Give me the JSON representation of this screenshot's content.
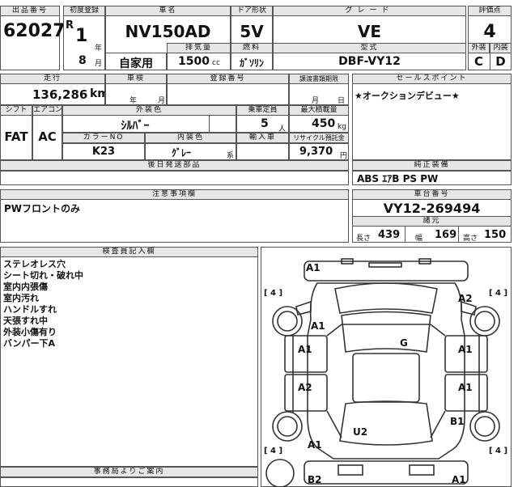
{
  "row1": {
    "lot_label": "出品番号",
    "lot": "62027",
    "reg_label": "初度登録",
    "era": "R",
    "year": "1",
    "year_unit": "年",
    "month": "8",
    "month_unit": "月",
    "car_label": "車名",
    "car": "NV150AD",
    "use": "自家用",
    "disp_label": "排気量",
    "disp": "1500",
    "disp_unit": "cc",
    "door_label": "ドア形状",
    "door": "5V",
    "fuel_label": "燃料",
    "fuel": "ｶﾞｿﾘﾝ",
    "grade_label": "グレード",
    "grade": "VE",
    "model_label": "型式",
    "model": "DBF-VY12",
    "score_label": "評価点",
    "score": "4",
    "ext_label": "外装",
    "ext": "C",
    "int_label": "内装",
    "int": "D"
  },
  "row2": {
    "km_label": "走行",
    "km": "136,286",
    "km_unit": "km",
    "shaken_label": "車検",
    "shaken_year": "年",
    "shaken_month": "月",
    "plate_label": "登録番号",
    "transfer_label": "譲渡書類期限",
    "transfer_month": "月",
    "transfer_day": "日",
    "shift_label": "シフト",
    "shift": "FAT",
    "ac_label": "エアコン",
    "ac": "AC",
    "color_label": "外装色",
    "color": "ｼﾙﾊﾞｰ",
    "capacity_label": "乗車定員",
    "capacity": "5",
    "capacity_unit": "人",
    "load_label": "最大積載量",
    "load": "450",
    "load_unit": "kg",
    "color_no_label": "カラーNO",
    "color_no": "K23",
    "int_color_label": "内装色",
    "int_color": "ｸﾞﾚｰ",
    "int_color_unit": "系",
    "import_label": "輸入車",
    "recycle_label": "リサイクル預託金",
    "recycle": "9,370",
    "recycle_unit": "円",
    "later_label": "後日発送部品"
  },
  "sales": {
    "label": "セールスポイント",
    "text": "★オークションデビュー★",
    "equip_label": "純正装備",
    "equip": "ABS ｴｱB PS PW"
  },
  "notes": {
    "label": "注意事項欄",
    "text": "PWフロントのみ"
  },
  "chassis": {
    "label": "車台番号",
    "value": "VY12-269494",
    "dims_label": "諸元",
    "len_label": "長さ",
    "len": "439",
    "wid_label": "幅",
    "wid": "169",
    "hgt_label": "高さ",
    "hgt": "150"
  },
  "inspector": {
    "label": "検査員記入欄",
    "lines": [
      "ステレオレス穴",
      "シート切れ・破れ中",
      "室内内張傷",
      "室内汚れ",
      "ハンドルすれ",
      "天張すれ中",
      "外装小傷有り",
      "バンパー下A"
    ]
  },
  "office": {
    "label": "事務局よりご案内"
  },
  "diagram": {
    "marks": [
      "A1",
      "A2",
      "A1",
      "A1",
      "A1",
      "A2",
      "A1",
      "G",
      "B1",
      "A1",
      "U2",
      "B2",
      "A1"
    ],
    "tires": [
      "[ 4 ]",
      "[ 4 ]",
      "[ 4 ]",
      "[ 4 ]"
    ]
  }
}
